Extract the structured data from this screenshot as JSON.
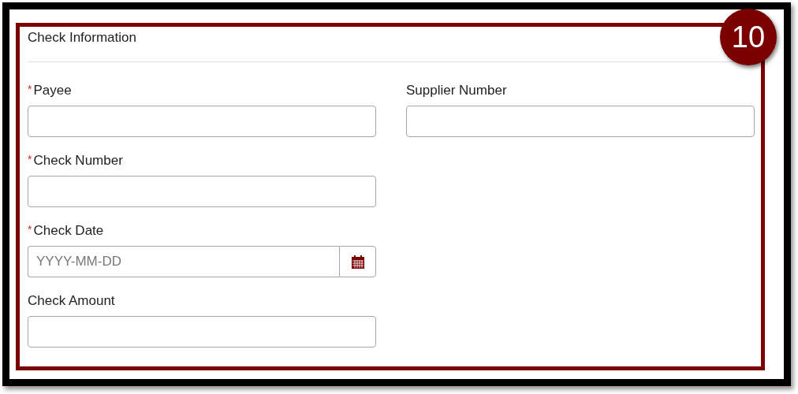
{
  "callout": {
    "number": "10"
  },
  "section": {
    "title": "Check Information"
  },
  "rows": [
    [
      {
        "label": "Payee",
        "required_mark": "*",
        "kind": "text"
      },
      {
        "label": "Supplier Number",
        "kind": "text"
      }
    ],
    [
      {
        "label": "Check Number",
        "required_mark": "*",
        "kind": "text"
      }
    ],
    [
      {
        "label": "Check Date",
        "required_mark": "*",
        "kind": "date",
        "placeholder": "YYYY-MM-DD"
      }
    ],
    [
      {
        "label": "Check Amount",
        "kind": "text"
      }
    ]
  ]
}
